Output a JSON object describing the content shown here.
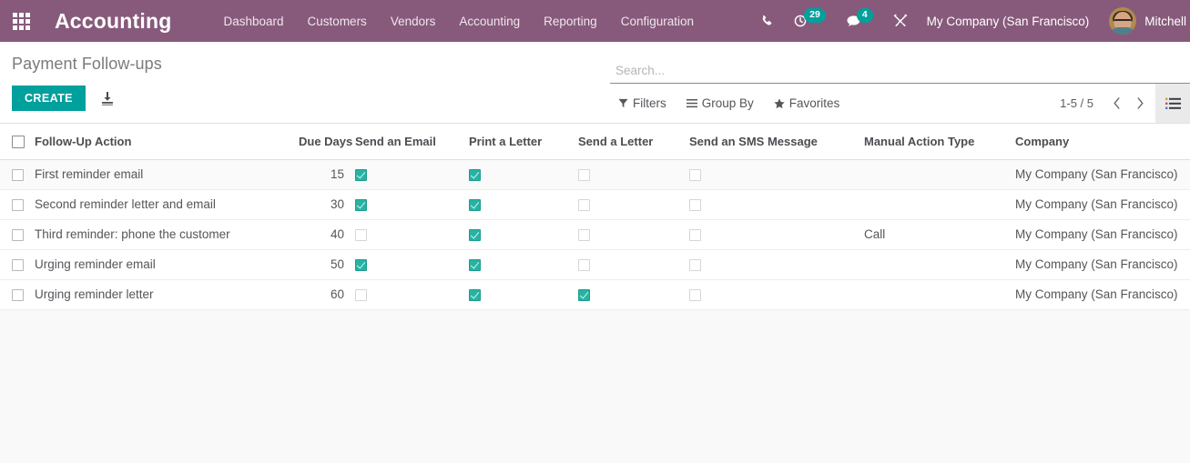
{
  "theme": {
    "navbar_bg": "#875a7b",
    "accent_teal": "#00a09d",
    "checkbox_teal": "#26b3a4"
  },
  "navbar": {
    "apps_icon": "apps-grid-icon",
    "brand": "Accounting",
    "menu": [
      {
        "label": "Dashboard"
      },
      {
        "label": "Customers"
      },
      {
        "label": "Vendors"
      },
      {
        "label": "Accounting"
      },
      {
        "label": "Reporting"
      },
      {
        "label": "Configuration"
      }
    ],
    "icons": {
      "phone": "phone-icon",
      "activity": "clock-activity-icon",
      "activity_count": "29",
      "messages": "chat-bubble-icon",
      "messages_count": "4",
      "debug": "wrench-tools-icon"
    },
    "company": "My Company (San Francisco)",
    "user": "Mitchell",
    "avatar": "user-avatar"
  },
  "control_panel": {
    "title": "Payment Follow-ups",
    "create_label": "CREATE",
    "import_icon": "import-download-icon",
    "search": {
      "placeholder": "Search...",
      "value": ""
    },
    "filters_label": "Filters",
    "groupby_label": "Group By",
    "favorites_label": "Favorites",
    "pager": "1-5 / 5",
    "prev_icon": "chevron-left-icon",
    "next_icon": "chevron-right-icon",
    "view_list_icon": "list-view-icon"
  },
  "table": {
    "columns": [
      {
        "key": "select",
        "label": ""
      },
      {
        "key": "action",
        "label": "Follow-Up Action"
      },
      {
        "key": "days",
        "label": "Due Days"
      },
      {
        "key": "email",
        "label": "Send an Email"
      },
      {
        "key": "print",
        "label": "Print a Letter"
      },
      {
        "key": "letter",
        "label": "Send a Letter"
      },
      {
        "key": "sms",
        "label": "Send an SMS Message"
      },
      {
        "key": "manual",
        "label": "Manual Action Type"
      },
      {
        "key": "company",
        "label": "Company"
      }
    ],
    "rows": [
      {
        "action": "First reminder email",
        "days": "15",
        "email": true,
        "print": true,
        "letter": false,
        "sms": false,
        "manual": "",
        "company": "My Company (San Francisco)"
      },
      {
        "action": "Second reminder letter and email",
        "days": "30",
        "email": true,
        "print": true,
        "letter": false,
        "sms": false,
        "manual": "",
        "company": "My Company (San Francisco)"
      },
      {
        "action": "Third reminder: phone the customer",
        "days": "40",
        "email": false,
        "print": true,
        "letter": false,
        "sms": false,
        "manual": "Call",
        "company": "My Company (San Francisco)"
      },
      {
        "action": "Urging reminder email",
        "days": "50",
        "email": true,
        "print": true,
        "letter": false,
        "sms": false,
        "manual": "",
        "company": "My Company (San Francisco)"
      },
      {
        "action": "Urging reminder letter",
        "days": "60",
        "email": false,
        "print": true,
        "letter": true,
        "sms": false,
        "manual": "",
        "company": "My Company (San Francisco)"
      }
    ]
  }
}
